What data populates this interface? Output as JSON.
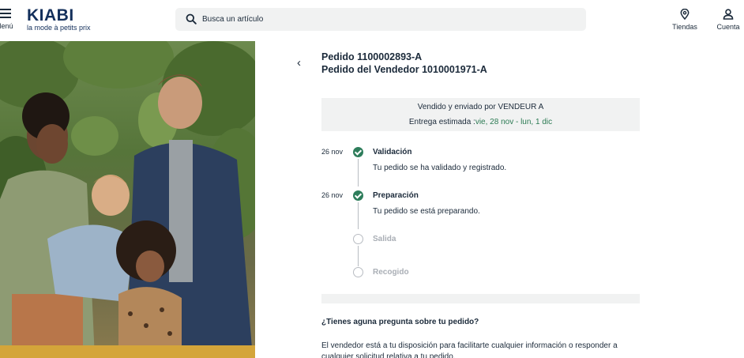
{
  "header": {
    "menu_label": "Menú",
    "logo_wordmark": "KIABI",
    "logo_tagline": "la mode à petits prix",
    "search_placeholder": "Busca un artículo",
    "stores_label": "Tiendas",
    "account_label": "Cuenta",
    "icons": {
      "menu": "hamburger-icon",
      "search": "search-icon",
      "stores": "location-pin-icon",
      "account": "user-icon"
    }
  },
  "order": {
    "order_line": "Pedido 1100002893-A",
    "vendor_order_line": "Pedido del Vendedor 1010001971-A",
    "sold_by": "Vendido y enviado por VENDEUR A",
    "delivery_label": "Entrega estimada :",
    "delivery_dates": "vie, 28 nov - lun, 1 dic"
  },
  "timeline": [
    {
      "date": "26 nov",
      "name": "Validación",
      "description": "Tu pedido se ha validado y registrado.",
      "status": "done"
    },
    {
      "date": "26 nov",
      "name": "Preparación",
      "description": "Tu pedido se está preparando.",
      "status": "done"
    },
    {
      "date": "",
      "name": "Salida",
      "description": "",
      "status": "pending"
    },
    {
      "date": "",
      "name": "Recogido",
      "description": "",
      "status": "pending"
    }
  ],
  "help": {
    "question": "¿Tienes aguna pregunta sobre tu pedido?",
    "text": "El vendedor está a tu disposición para facilitarte cualquier información o responder a cualquier solicitud relativa a tu pedido."
  },
  "colors": {
    "brand_navy": "#132f5b",
    "status_green": "#2e7d5b",
    "date_green": "#2b7a53",
    "panel_gray": "#f1f2f2"
  }
}
